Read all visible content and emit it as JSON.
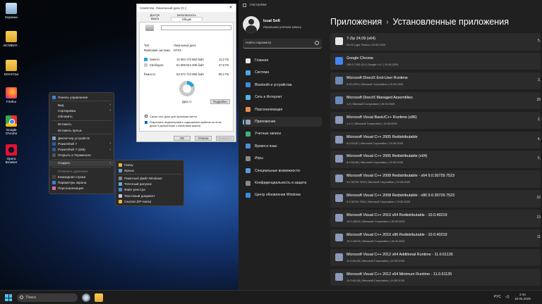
{
  "desktop": {
    "icons": [
      {
        "label": "Корзина"
      },
      {
        "label": "АКТИВАТ..."
      },
      {
        "label": "БОНУСЫ"
      },
      {
        "label": "Firefox"
      },
      {
        "label": "Google Chrome"
      },
      {
        "label": "Opera Browser"
      }
    ]
  },
  "context_menu": {
    "items": [
      {
        "label": "Панель управления",
        "color": "#3b82d6"
      },
      {
        "label": "Вид",
        "submenu": true
      },
      {
        "label": "Сортировка",
        "submenu": true
      },
      {
        "label": "Обновить"
      },
      {
        "label": "Вставить"
      },
      {
        "label": "Вставить ярлык"
      },
      {
        "label": "Диспетчер устройств",
        "color": "#7aa0c8"
      },
      {
        "label": "PowerShell 7",
        "submenu": true,
        "color": "#2a5aa8"
      },
      {
        "label": "PowerShell 7 (x86)",
        "submenu": true,
        "color": "#2a5aa8"
      },
      {
        "label": "Открыть в Терминале",
        "color": "#555"
      },
      {
        "label": "Создать",
        "submenu": true,
        "highlighted": true
      },
      {
        "label": "Отменить удаление",
        "disabled": true
      },
      {
        "label": "Командная строка",
        "color": "#444"
      },
      {
        "label": "Параметры экрана",
        "color": "#3b82d6"
      },
      {
        "label": "Персонализация",
        "color": "#d070a0"
      }
    ],
    "submenu_create": [
      {
        "label": "Папку",
        "color": "#e8b84a"
      },
      {
        "label": "Ярлык",
        "color": "#6aa0d8"
      },
      {
        "label": "Пакетный файл Windows",
        "color": "#888"
      },
      {
        "label": "Точечный рисунок",
        "color": "#5fb0e0"
      },
      {
        "label": "Файл реестра",
        "color": "#4a90d8"
      },
      {
        "label": "Текстовый документ",
        "color": "#c8c8c8"
      },
      {
        "label": "Сжатая ZIP-папка",
        "color": "#e8b84a"
      }
    ]
  },
  "properties_dialog": {
    "title": "Свойства: Локальный диск (C:)",
    "close": "✕",
    "tabs": [
      "Доступ",
      "Безопасность",
      "Квота",
      "Общие",
      "Сервис",
      "Оборудование"
    ],
    "type_label": "Тип:",
    "type_value": "Локальный диск",
    "fs_label": "Файловая система:",
    "fs_value": "NTFS",
    "used_label": "Занято:",
    "used_bytes": "12 063 170 560 байт",
    "used_gb": "11,2 ГБ",
    "free_label": "Свободно:",
    "free_bytes": "51 509 542 496 байт",
    "free_gb": "47,9 ГБ",
    "capacity_label": "Ёмкость:",
    "capacity_bytes": "63 572 713 056 байт",
    "capacity_gb": "59,2 ГБ",
    "drive_label": "Диск C:",
    "cleanup_button": "Подробно",
    "used_fraction": 0.19,
    "compress_checkbox": "Сжать этот диск для экономии места",
    "index_checkbox": "Разрешить индексировать содержимое файлов на этом диске в дополнение к свойствам файла",
    "ok_button": "ОК",
    "cancel_button": "Отмена",
    "apply_button": "Применить"
  },
  "settings": {
    "window_title": "Настройки",
    "user_name": "Izual Soft",
    "user_sub": "Локальная учетная запись",
    "search_placeholder": "Найти параметр",
    "nav": [
      {
        "label": "Главная",
        "color": "#e8e8e8"
      },
      {
        "label": "Система",
        "color": "#4aa8e8"
      },
      {
        "label": "Bluetooth и устройства",
        "color": "#3a8be0"
      },
      {
        "label": "Сеть и Интернет",
        "color": "#5ab0e8"
      },
      {
        "label": "Персонализация",
        "color": "#e0904a"
      },
      {
        "label": "Приложения",
        "color": "#9aa0b8",
        "selected": true
      },
      {
        "label": "Учетные записи",
        "color": "#40b080"
      },
      {
        "label": "Время и язык",
        "color": "#4a90d8"
      },
      {
        "label": "Игры",
        "color": "#8a8a8a"
      },
      {
        "label": "Специальные возможности",
        "color": "#5a9ae0"
      },
      {
        "label": "Конфиденциальность и защита",
        "color": "#8a8a8a"
      },
      {
        "label": "Центр обновления Windows",
        "color": "#3a8be0"
      }
    ],
    "breadcrumb_parent": "Приложения",
    "breadcrumb_sep": "›",
    "breadcrumb_current": "Установленные приложения",
    "apps": [
      {
        "name": "7-Zip 24.09 (x64)",
        "meta": "24.09  |  Igor Pavlov  |  19.05.2025",
        "size": "5,",
        "color": "#e8e8e8"
      },
      {
        "name": "Google Chrome",
        "meta": "136.0.7103.114  |  Google LLC  |  19.05.2025",
        "size": "",
        "color": "#4285f4"
      },
      {
        "name": "Microsoft DirectX End-User Runtime",
        "meta": "9.29.1974  |  Microsoft Corporation  |  19.05.2025",
        "size": "3,",
        "color": "#6a8ab8"
      },
      {
        "name": "Microsoft DirectX Managed Assemblies",
        "meta": "1.0  |  Microsoft Corporation  |  19.05.2025",
        "size": "39",
        "color": "#6a8ab8"
      },
      {
        "name": "Microsoft Visual Basic/C++ Runtime (x86)",
        "meta": "1.1.0  |  Microsoft Corporation  |  19.05.2025",
        "size": "2,",
        "color": "#8a9ab8"
      },
      {
        "name": "Microsoft Visual C++ 2005 Redistributable",
        "meta": "8.0.61187  |  Microsoft Corporation  |  19.05.2025",
        "size": "4,",
        "color": "#8a9ab8"
      },
      {
        "name": "Microsoft Visual C++ 2005 Redistributable (x64)",
        "meta": "8.0.61186  |  Microsoft Corporation  |  19.05.2025",
        "size": "6,",
        "color": "#8a9ab8"
      },
      {
        "name": "Microsoft Visual C++ 2008 Redistributable - x64 9.0.30729.7523",
        "meta": "9.0.30729.7523  |  Microsoft Corporation  |  19.05.2025",
        "size": "",
        "color": "#8a9ab8"
      },
      {
        "name": "Microsoft Visual C++ 2008 Redistributable - x86 9.0.30729.7523",
        "meta": "9.0.30729.7523  |  Microsoft Corporation  |  19.05.2025",
        "size": "10",
        "color": "#8a9ab8"
      },
      {
        "name": "Microsoft Visual C++ 2010  x64 Redistributable - 10.0.40219",
        "meta": "10.0.40219  |  Microsoft Corporation  |  19.05.2025",
        "size": "13",
        "color": "#8a9ab8"
      },
      {
        "name": "Microsoft Visual C++ 2010  x86 Redistributable - 10.0.40219",
        "meta": "10.0.40219  |  Microsoft Corporation  |  19.05.2025",
        "size": "11",
        "color": "#8a9ab8"
      },
      {
        "name": "Microsoft Visual C++ 2012 x64 Additional Runtime - 11.0.61135",
        "meta": "11.0.61135  |  Microsoft Corporation  |  19.05.2025",
        "size": "",
        "color": "#8a9ab8"
      },
      {
        "name": "Microsoft Visual C++ 2012 x64 Minimum Runtime - 11.0.61135",
        "meta": "11.0.61135  |  Microsoft Corporation  |  19.05.2025",
        "size": "",
        "color": "#8a9ab8"
      }
    ]
  },
  "taskbar": {
    "search_placeholder": "Поиск",
    "lang": "РУС",
    "time": "2:34",
    "date": "19.05.2025"
  }
}
